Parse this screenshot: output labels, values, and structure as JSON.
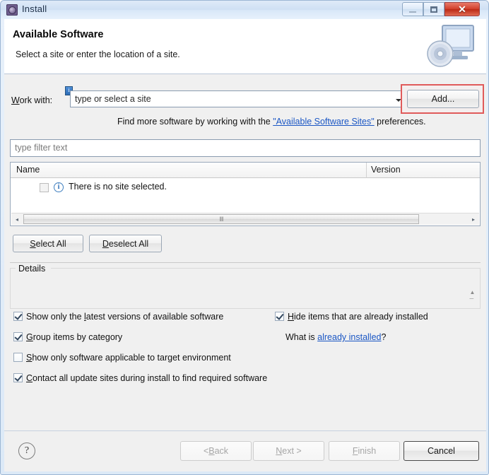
{
  "window": {
    "title": "Install",
    "icon": "install-icon",
    "controls": {
      "minimize": "minimize-icon",
      "maximize": "maximize-icon",
      "close": "✕"
    }
  },
  "header": {
    "title": "Available Software",
    "subtitle": "Select a site or enter the location of a site.",
    "banner_icon": "monitor-with-disc-icon"
  },
  "work_with": {
    "label_prefix": "W",
    "label_rest": "ork with:",
    "decoration_icon": "info-decoration-icon",
    "combo_value": "type or select a site",
    "combo_placeholder": "type or select a site",
    "dropdown_icon": "chevron-down-icon",
    "add_button": "Add...",
    "add_mnemonic": "A",
    "highlight_color": "#e05a5a"
  },
  "hint": {
    "before": "Find more software by working with the ",
    "link": "\"Available Software Sites\"",
    "after": " preferences."
  },
  "filter": {
    "placeholder": "type filter text",
    "value": ""
  },
  "table": {
    "columns": [
      "Name",
      "Version"
    ],
    "rows": [
      {
        "checked": false,
        "icon": "info-icon",
        "name": "There is no site selected.",
        "version": ""
      }
    ],
    "scrollbar": {
      "left_arrow": "◂",
      "right_arrow": "▸",
      "grip": "‖‖"
    }
  },
  "selection_buttons": {
    "select_all": "elect All",
    "select_all_mnemonic": "S",
    "deselect_all": "eselect All",
    "deselect_all_mnemonic": "D"
  },
  "details": {
    "label": "Details",
    "content": "",
    "scroll_up_icon": "scroll-up-icon"
  },
  "options": [
    {
      "id": "show-latest-versions",
      "checked": true,
      "before": "Show only the ",
      "mnemonic": "l",
      "after": "atest versions of available software"
    },
    {
      "id": "group-by-category",
      "checked": true,
      "before": "",
      "mnemonic": "G",
      "after": "roup items by category"
    },
    {
      "id": "show-applicable-target",
      "checked": false,
      "before": "",
      "mnemonic": "S",
      "after": "how only software applicable to target environment"
    },
    {
      "id": "contact-update-sites",
      "checked": true,
      "before": "",
      "mnemonic": "C",
      "after": "ontact all update sites during install to find required software"
    },
    {
      "id": "hide-installed-items",
      "checked": true,
      "before": "",
      "mnemonic": "H",
      "after": "ide items that are already installed"
    }
  ],
  "what_is": {
    "before": "What is ",
    "link": "already installed",
    "after": "?"
  },
  "footer": {
    "help_icon": "?",
    "back": {
      "before": "< ",
      "mnemonic": "B",
      "after": "ack",
      "disabled": true
    },
    "next": {
      "before": "",
      "mnemonic": "N",
      "after": "ext >",
      "disabled": true
    },
    "finish": {
      "before": "",
      "mnemonic": "F",
      "after": "inish",
      "disabled": true
    },
    "cancel": {
      "before": "",
      "mnemonic": "",
      "after": "Cancel",
      "disabled": false
    }
  }
}
